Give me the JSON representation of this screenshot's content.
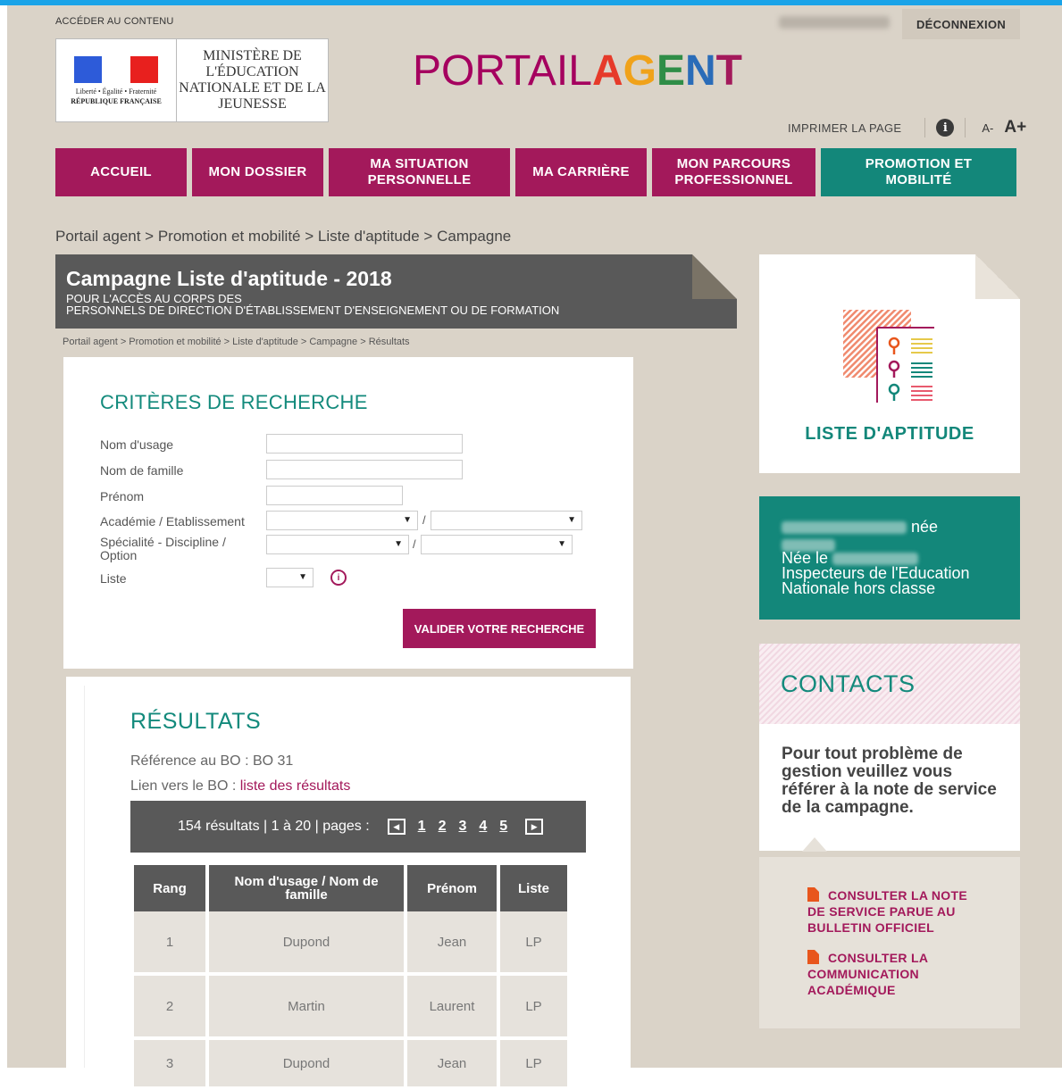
{
  "header": {
    "skip_link": "ACCÉDER AU CONTENU",
    "logout": "DÉCONNEXION",
    "logo": {
      "devise": "Liberté • Égalité • Fraternité",
      "republique": "RÉPUBLIQUE FRANÇAISE",
      "ministere": "MINISTÈRE DE L'ÉDUCATION NATIONALE ET DE LA JEUNESSE"
    },
    "portal_title_part1": "PORTAIL",
    "portal_title_part2": "AGENT",
    "tools": {
      "print": "IMPRIMER LA PAGE",
      "info_icon": "info-icon",
      "font_smaller": "A-",
      "font_bigger": "A+"
    },
    "colors": {
      "brand_magenta": "#a3195b",
      "brand_teal": "#13877a",
      "top_bar": "#1aa3e8",
      "page_bg": "#dad3c8"
    }
  },
  "nav": {
    "items": [
      {
        "label": "ACCUEIL"
      },
      {
        "label": "MON DOSSIER"
      },
      {
        "label": "MA SITUATION PERSONNELLE"
      },
      {
        "label": "MA CARRIÈRE"
      },
      {
        "label": "MON PARCOURS PROFESSIONNEL"
      },
      {
        "label": "PROMOTION ET MOBILITÉ"
      }
    ]
  },
  "breadcrumb": "Portail agent > Promotion et mobilité > Liste d'aptitude > Campagne",
  "campaign": {
    "title": "Campagne Liste d'aptitude - 2018",
    "subtitle_1": "POUR L'ACCÈS AU CORPS DES",
    "subtitle_2": "PERSONNELS DE DIRECTION D'ÉTABLISSEMENT D'ENSEIGNEMENT OU DE FORMATION",
    "mini_breadcrumb": "Portail agent > Promotion et mobilité > Liste d'aptitude > Campagne > Résultats"
  },
  "search": {
    "heading": "CRITÈRES DE RECHERCHE",
    "labels": {
      "nom_usage": "Nom d'usage",
      "nom_famille": "Nom de famille",
      "prenom": "Prénom",
      "academie": "Académie / Etablissement",
      "specialite": "Spécialité - Discipline / Option",
      "liste": "Liste"
    },
    "values": {
      "nom_usage": "",
      "nom_famille": "",
      "prenom": ""
    },
    "separator": "/",
    "submit": "VALIDER VOTRE RECHERCHE"
  },
  "results": {
    "heading": "RÉSULTATS",
    "bo_ref_label": "Référence au BO : ",
    "bo_ref_value": "BO 31",
    "bo_link_label": "Lien vers le BO : ",
    "bo_link_text": "liste des résultats",
    "pager": {
      "summary": "154 résultats | 1 à 20 | pages :",
      "pages": [
        "1",
        "2",
        "3",
        "4",
        "5"
      ]
    },
    "columns": [
      "Rang",
      "Nom d'usage / Nom de famille",
      "Prénom",
      "Liste"
    ],
    "rows": [
      {
        "rang": "1",
        "nom": "Dupond",
        "prenom": "Jean",
        "liste": "LP"
      },
      {
        "rang": "2",
        "nom": "Martin",
        "prenom": "Laurent",
        "liste": "LP"
      },
      {
        "rang": "3",
        "nom": "Dupond",
        "prenom": "Jean",
        "liste": "LP"
      }
    ]
  },
  "sidebar": {
    "liste_label": "LISTE D'APTITUDE",
    "profile": {
      "nee_suffix": "née",
      "nee_le": "Née le",
      "grade_1": "Inspecteurs de l'Education",
      "grade_2": "Nationale hors classe"
    },
    "contacts": {
      "heading": "CONTACTS",
      "body": "Pour tout problème de gestion veuillez vous référer à la note de service de la campagne.",
      "links": [
        {
          "text": "CONSULTER LA NOTE DE SERVICE PARUE AU BULLETIN OFFICIEL"
        },
        {
          "text": "CONSULTER LA COMMUNICATION ACADÉMIQUE"
        }
      ]
    }
  }
}
